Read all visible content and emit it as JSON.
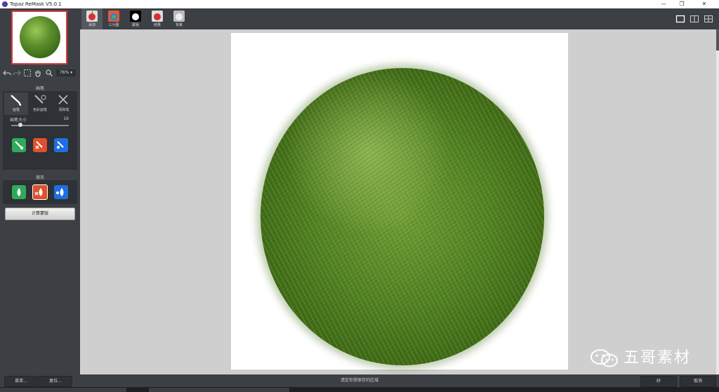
{
  "window": {
    "title": "Topaz ReMask V5.0.1",
    "minimize_glyph": "—",
    "restore_glyph": "❐",
    "close_glyph": "✕"
  },
  "left_panel": {
    "zoom_label": "76% ▾",
    "brush_section_label": "画笔",
    "brush_tools": [
      {
        "label": "画笔",
        "icon": "brush-icon"
      },
      {
        "label": "色彩画笔",
        "icon": "color-brush-icon"
      },
      {
        "label": "调和笔",
        "icon": "blend-brush-icon"
      }
    ],
    "brush_size_label": "画笔大小",
    "brush_size_value": "16",
    "brush_size_fraction": 0.16,
    "fill_section_label": "填充",
    "compute_button": "计算蒙版"
  },
  "top_tabs": [
    {
      "label": "添加",
      "icon": "apple-red-icon"
    },
    {
      "label": "三分图",
      "icon": "trimap-icon"
    },
    {
      "label": "蒙版",
      "icon": "apple-black-icon"
    },
    {
      "label": "结果",
      "icon": "apple-result-icon"
    },
    {
      "label": "背景",
      "icon": "background-icon"
    }
  ],
  "bottom_bar": {
    "menu_button": "菜单...",
    "reset_button": "复位...",
    "status_text": "请定你想保存的区域",
    "ok_button": "好",
    "cancel_button": "取消"
  },
  "watermark": {
    "text": "五哥素材"
  },
  "colors": {
    "panel": "#3c3f44",
    "canvas": "#cfcfcf",
    "keep_green": "#2faa5b",
    "drop_red": "#e0502a",
    "compute_blue": "#1f6fe0",
    "thumb_border": "#d83a3a"
  }
}
